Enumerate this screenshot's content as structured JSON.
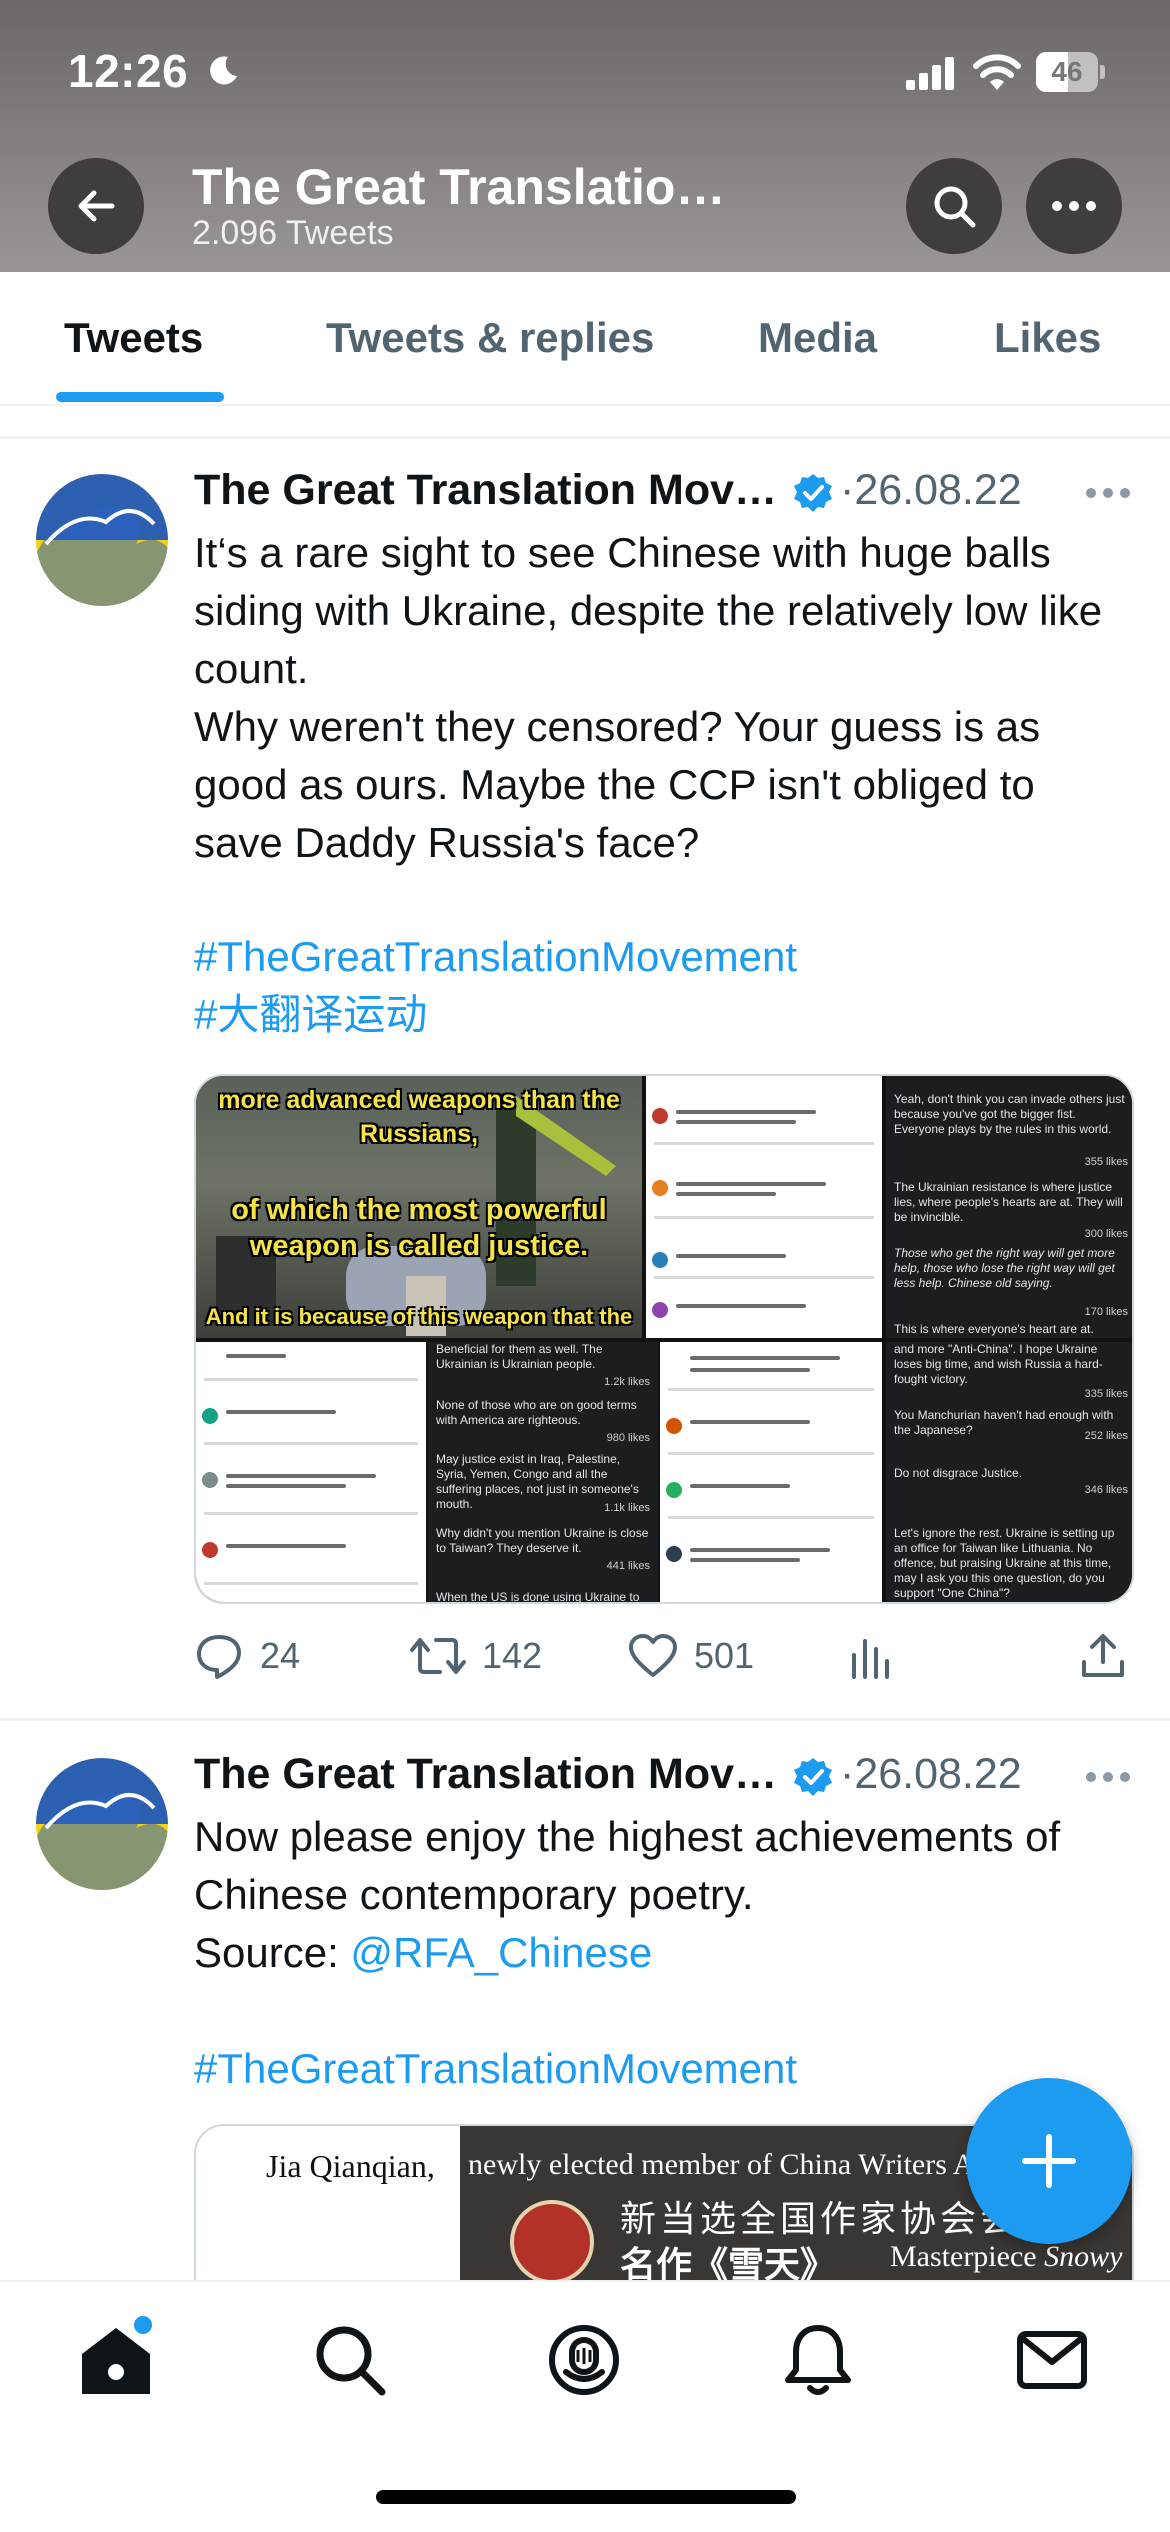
{
  "status_bar": {
    "time": "12:26",
    "battery": "46"
  },
  "header": {
    "title": "The Great Translatio…",
    "subtitle": "2.096 Tweets"
  },
  "tabs": [
    {
      "label": "Tweets",
      "active": true
    },
    {
      "label": "Tweets & replies",
      "active": false
    },
    {
      "label": "Media",
      "active": false
    },
    {
      "label": "Likes",
      "active": false
    }
  ],
  "tweets": [
    {
      "author": "The Great Translation Mov…",
      "date": "·26.08.22",
      "text": "It‘s a rare sight to see Chinese with huge balls siding with Ukraine, despite the relatively low like count.\nWhy weren't they censored? Your guess is as good as ours. Maybe the CCP isn't obliged to save Daddy Russia's face?",
      "hashtags": [
        "#TheGreatTranslationMovement",
        "#大翻译运动"
      ],
      "media": {
        "captions": [
          "more advanced weapons than the",
          "Russians,",
          "of which the most powerful",
          "weapon is called justice.",
          "And it is because of this weapon that the"
        ],
        "panel_dark_1": [
          {
            "text": "Yeah, don't think you can invade others just because you've got the bigger fist. Everyone plays by the rules in this world.",
            "likes": "355 likes"
          },
          {
            "text": "The Ukrainian resistance is where justice lies, where people's hearts are at. They will be invincible.",
            "likes": "300 likes"
          },
          {
            "text": "Those who get the right way will get more help, those who lose the right way will get less help.\nChinese old saying.",
            "likes": "170 likes"
          },
          {
            "text": "This is where everyone's heart are at.",
            "likes": ""
          }
        ],
        "panel_dark_2": [
          {
            "text": "Beneficial for them as well. The Ukrainian is Ukrainian people.",
            "likes": "1.2k likes"
          },
          {
            "text": "None of those who are on good terms with America are righteous.",
            "likes": "980 likes"
          },
          {
            "text": "May justice exist in Iraq, Palestine, Syria, Yemen, Congo and all the suffering places, not just in someone's mouth.",
            "likes": "1.1k likes"
          },
          {
            "text": "Why didn't you mention Ukraine is close to Taiwan? They deserve it.",
            "likes": "441 likes"
          },
          {
            "text": "When the US is done using Ukraine to deal",
            "likes": ""
          }
        ],
        "panel_dark_3": [
          {
            "text": "and more \"Anti-China\". I hope Ukraine loses big time, and wish Russia a hard-fought victory.",
            "likes": "335 likes"
          },
          {
            "text": "You Manchurian haven't had enough with the Japanese?",
            "likes": "252 likes"
          },
          {
            "text": "Do not disgrace Justice.",
            "likes": "346 likes"
          },
          {
            "text": "Let's ignore the rest. Ukraine is setting up an office for Taiwan like Lithuania. No offence, but praising Ukraine at this time, may I ask you this one question, do you support \"One China\"?",
            "likes": ""
          }
        ]
      },
      "stats": {
        "replies": "24",
        "retweets": "142",
        "likes": "501"
      }
    },
    {
      "author": "The Great Translation Mov…",
      "date": "·26.08.22",
      "text_prefix": "Now please enjoy the highest achievements of Chinese contemporary poetry.\nSource: ",
      "mention": "@RFA_Chinese",
      "hashtags": [
        "#TheGreatTranslationMovement"
      ],
      "media": {
        "left_text": "Jia Qianqian,",
        "top_text": "newly elected member of China Writers As",
        "cn_line1": "新当选全国作家协会会员",
        "cn_line2": "名作《雪天》",
        "en_prefix": "Masterpiece ",
        "en_italic": "Snowy"
      }
    }
  ],
  "colors": {
    "accent": "#1d9bf0",
    "text": "#0f1419",
    "secondary": "#536471"
  }
}
